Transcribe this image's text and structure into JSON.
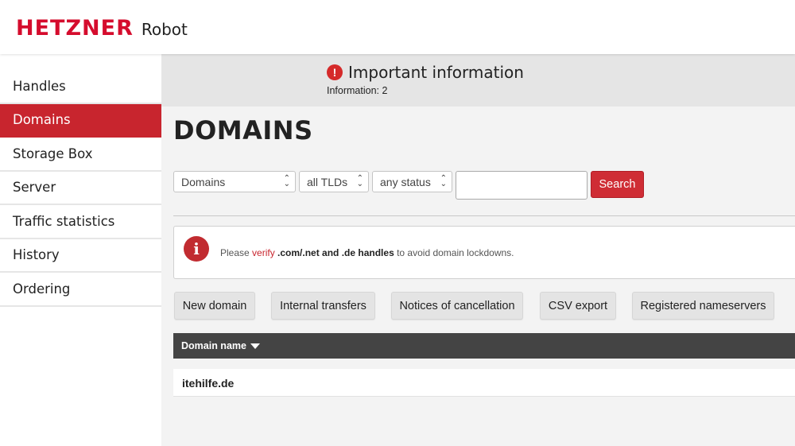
{
  "header": {
    "brand": "HETZNER",
    "product": "Robot"
  },
  "sidebar": {
    "items": [
      {
        "label": "Handles",
        "active": false
      },
      {
        "label": "Domains",
        "active": true
      },
      {
        "label": "Storage Box",
        "active": false
      },
      {
        "label": "Server",
        "active": false
      },
      {
        "label": "Traffic statistics",
        "active": false
      },
      {
        "label": "History",
        "active": false
      },
      {
        "label": "Ordering",
        "active": false
      }
    ]
  },
  "info_banner": {
    "title": "Important information",
    "count_text": "Information: 2",
    "icon": "exclamation-circle-icon",
    "icon_glyph": "!"
  },
  "page": {
    "title": "DOMAINS"
  },
  "filters": {
    "type_select": "Domains",
    "tld_select": "all TLDs",
    "status_select": "any status",
    "search_value": "",
    "search_button": "Search"
  },
  "notice": {
    "icon": "info-icon",
    "icon_glyph": "i",
    "text_before": "Please ",
    "link_text": "verify",
    "bold_text": ".com/.net and .de handles",
    "text_after": " to avoid domain lockdowns."
  },
  "actions": [
    "New domain",
    "Internal transfers",
    "Notices of cancellation",
    "CSV export",
    "Registered nameservers"
  ],
  "table": {
    "columns": [
      {
        "label": "Domain name",
        "sort": "desc"
      }
    ],
    "rows": [
      {
        "domain": "itehilfe.de"
      }
    ]
  },
  "colors": {
    "brand_red": "#d50c2d",
    "active_nav": "#c8252e",
    "table_header": "#444444"
  }
}
